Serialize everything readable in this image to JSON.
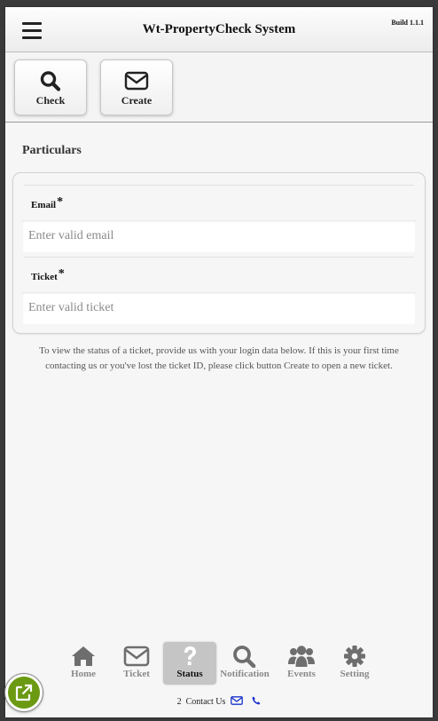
{
  "header": {
    "title": "Wt-PropertyCheck System",
    "build": "Build 1.1.1",
    "menu_icon": "hamburger-icon"
  },
  "actions": [
    {
      "label": "Check",
      "icon": "search-icon"
    },
    {
      "label": "Create",
      "icon": "envelope-icon"
    }
  ],
  "section": {
    "title": "Particulars"
  },
  "form": {
    "email_label": "Email",
    "email_required": "*",
    "email_placeholder": "Enter valid email",
    "email_value": "",
    "ticket_label": "Ticket",
    "ticket_required": "*",
    "ticket_placeholder": "Enter valid ticket",
    "ticket_value": ""
  },
  "info": {
    "text": "To view the status of a ticket, provide us with your login data below. If this is your first time contacting us or you've lost the ticket ID, please click button Create to open a new ticket."
  },
  "nav": {
    "items": [
      {
        "label": "Home",
        "icon": "home-icon",
        "active": false
      },
      {
        "label": "Ticket",
        "icon": "envelope-icon",
        "active": false
      },
      {
        "label": "Status",
        "icon": "question-icon",
        "active": true
      },
      {
        "label": "Notification",
        "icon": "search-icon",
        "active": false
      },
      {
        "label": "Events",
        "icon": "users-icon",
        "active": false
      },
      {
        "label": "Setting",
        "icon": "gear-icon",
        "active": false
      }
    ]
  },
  "footer": {
    "count": "2",
    "contact_label": "Contact Us",
    "email_icon": "envelope-icon",
    "phone_icon": "phone-icon"
  },
  "fab": {
    "icon": "external-link-icon"
  },
  "colors": {
    "accent_green": "#6b9a12",
    "link_blue": "#1a33cc",
    "active_tab_bg": "#c5c5c5"
  }
}
